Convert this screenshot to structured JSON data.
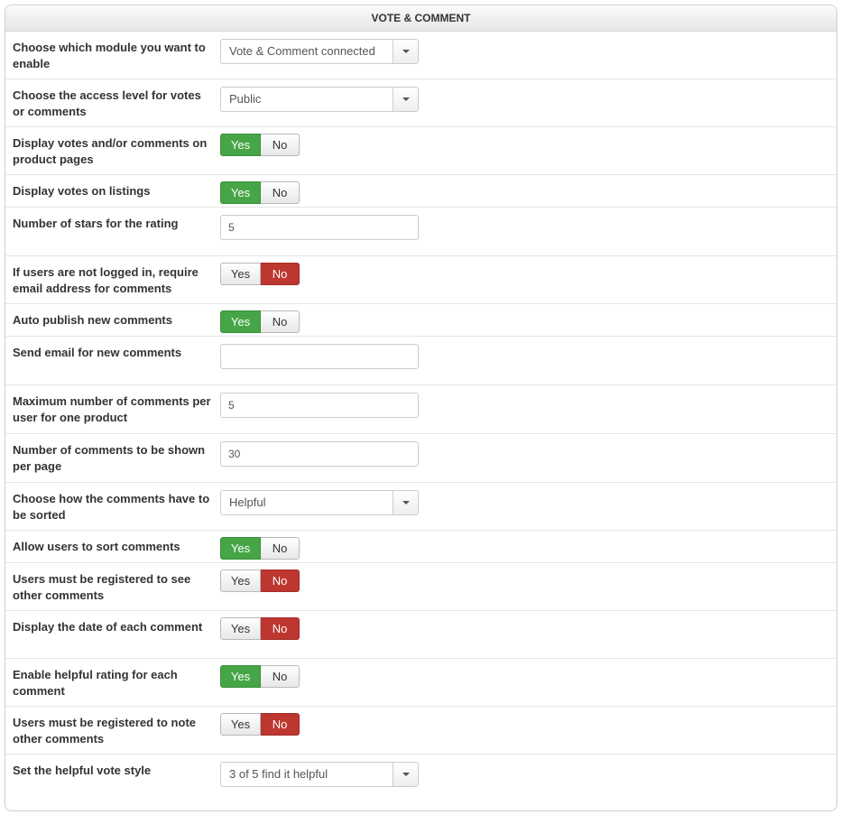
{
  "panel": {
    "title": "VOTE & COMMENT"
  },
  "rows": {
    "module": {
      "label": "Choose which module you want to enable",
      "value": "Vote & Comment connected"
    },
    "access": {
      "label": "Choose the access level for votes or comments",
      "value": "Public"
    },
    "display_product": {
      "label": "Display votes and/or comments on product pages",
      "value": "Yes"
    },
    "display_listings": {
      "label": "Display votes on listings",
      "value": "Yes"
    },
    "stars": {
      "label": "Number of stars for the rating",
      "value": "5"
    },
    "require_email": {
      "label": "If users are not logged in, require email address for comments",
      "value": "No"
    },
    "auto_publish": {
      "label": "Auto publish new comments",
      "value": "Yes"
    },
    "send_email": {
      "label": "Send email for new comments",
      "value": ""
    },
    "max_comments": {
      "label": "Maximum number of comments per user for one product",
      "value": "5"
    },
    "per_page": {
      "label": "Number of comments to be shown per page",
      "value": "30"
    },
    "sort_order": {
      "label": "Choose how the comments have to be sorted",
      "value": "Helpful"
    },
    "allow_sort": {
      "label": "Allow users to sort comments",
      "value": "Yes"
    },
    "registered_see": {
      "label": "Users must be registered to see other comments",
      "value": "No"
    },
    "display_date": {
      "label": "Display the date of each comment",
      "value": "No"
    },
    "helpful_rating": {
      "label": "Enable helpful rating for each comment",
      "value": "Yes"
    },
    "registered_note": {
      "label": "Users must be registered to note other comments",
      "value": "No"
    },
    "vote_style": {
      "label": "Set the helpful vote style",
      "value": "3 of 5 find it helpful"
    }
  },
  "toggle_labels": {
    "yes": "Yes",
    "no": "No"
  },
  "colors": {
    "yes_active": "#46a546",
    "no_active": "#bd362f"
  }
}
